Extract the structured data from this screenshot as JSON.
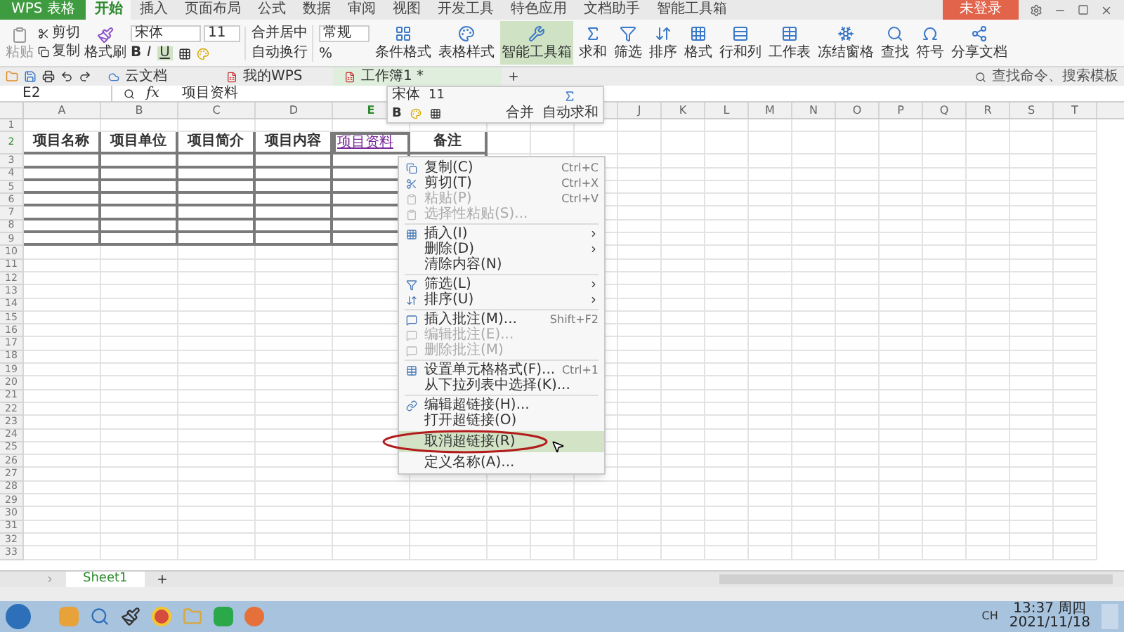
{
  "app_button": {
    "label": "WPS 表格"
  },
  "menu_tabs": [
    {
      "label": "开始",
      "selected": true
    },
    {
      "label": "插入",
      "selected": false
    },
    {
      "label": "页面布局",
      "selected": false
    },
    {
      "label": "公式",
      "selected": false
    },
    {
      "label": "数据",
      "selected": false
    },
    {
      "label": "审阅",
      "selected": false
    },
    {
      "label": "视图",
      "selected": false
    },
    {
      "label": "开发工具",
      "selected": false
    },
    {
      "label": "特色应用",
      "selected": false
    },
    {
      "label": "文档助手",
      "selected": false
    },
    {
      "label": "智能工具箱",
      "selected": false
    }
  ],
  "login_button": {
    "label": "未登录"
  },
  "ribbon": {
    "paste": "粘贴",
    "cut": "剪切",
    "copy": "复制",
    "format_painter": "格式刷",
    "font": "宋体",
    "font_size": "11",
    "bold": "B",
    "italic": "I",
    "underline": "U",
    "merge": "合并居中",
    "wrap": "自动换行",
    "number_format": "常规",
    "percent": "%",
    "tools": [
      {
        "label": "条件格式",
        "selected": false
      },
      {
        "label": "表格样式",
        "selected": false
      },
      {
        "label": "智能工具箱",
        "selected": true
      },
      {
        "label": "求和",
        "selected": false
      },
      {
        "label": "筛选",
        "selected": false
      },
      {
        "label": "排序",
        "selected": false
      },
      {
        "label": "格式",
        "selected": false
      },
      {
        "label": "行和列",
        "selected": false
      },
      {
        "label": "工作表",
        "selected": false
      },
      {
        "label": "冻结窗格",
        "selected": false
      },
      {
        "label": "查找",
        "selected": false
      },
      {
        "label": "符号",
        "selected": false
      },
      {
        "label": "分享文档",
        "selected": false
      }
    ],
    "search_placeholder": "查找命令、搜索模板"
  },
  "doc_tabs": [
    {
      "label": "云文档",
      "selected": false
    },
    {
      "label": "我的WPS",
      "selected": false
    },
    {
      "label": "工作簿1 *",
      "selected": true
    }
  ],
  "formula_bar": {
    "cell_ref": "E2",
    "fx": "fx",
    "value": "项目资料"
  },
  "mini_toolbar": {
    "font": "宋体",
    "size": "11",
    "bold": "B",
    "merge": "合并",
    "autosum": "自动求和"
  },
  "sheet": {
    "columns_left": [
      "A",
      "B",
      "C",
      "D",
      "E"
    ],
    "columns_right": [
      "J",
      "K",
      "L",
      "M",
      "N",
      "O",
      "P",
      "Q",
      "R",
      "S",
      "T"
    ],
    "rows": [
      "1",
      "2",
      "3",
      "4",
      "5",
      "6",
      "7",
      "8",
      "9",
      "10",
      "11",
      "12",
      "13",
      "14",
      "15",
      "16",
      "17",
      "18",
      "19",
      "20",
      "21",
      "22",
      "23",
      "24",
      "25",
      "26",
      "27",
      "28",
      "29",
      "30",
      "31",
      "32",
      "33"
    ],
    "header_cells": [
      {
        "text": "项目名称",
        "kind": "text",
        "selected": false
      },
      {
        "text": "项目单位",
        "kind": "text",
        "selected": false
      },
      {
        "text": "项目简介",
        "kind": "text",
        "selected": false
      },
      {
        "text": "项目内容",
        "kind": "text",
        "selected": false
      },
      {
        "text": "项目资料",
        "kind": "link",
        "selected": true
      },
      {
        "text": "备注",
        "kind": "text",
        "selected": false
      }
    ]
  },
  "context_menu": [
    {
      "kind": "item",
      "label": "复制(C)",
      "shortcut": "Ctrl+C",
      "disabled": false,
      "submenu": false,
      "selected": false
    },
    {
      "kind": "item",
      "label": "剪切(T)",
      "shortcut": "Ctrl+X",
      "disabled": false,
      "submenu": false,
      "selected": false
    },
    {
      "kind": "item",
      "label": "粘贴(P)",
      "shortcut": "Ctrl+V",
      "disabled": true,
      "submenu": false,
      "selected": false
    },
    {
      "kind": "item",
      "label": "选择性粘贴(S)...",
      "disabled": true,
      "submenu": false,
      "selected": false
    },
    {
      "kind": "separator"
    },
    {
      "kind": "item",
      "label": "插入(I)",
      "disabled": false,
      "submenu": true,
      "selected": false
    },
    {
      "kind": "item",
      "label": "删除(D)",
      "disabled": false,
      "submenu": true,
      "selected": false
    },
    {
      "kind": "item",
      "label": "清除内容(N)",
      "disabled": false,
      "submenu": false,
      "selected": false
    },
    {
      "kind": "separator"
    },
    {
      "kind": "item",
      "label": "筛选(L)",
      "disabled": false,
      "submenu": true,
      "selected": false
    },
    {
      "kind": "item",
      "label": "排序(U)",
      "disabled": false,
      "submenu": true,
      "selected": false
    },
    {
      "kind": "separator"
    },
    {
      "kind": "item",
      "label": "插入批注(M)...",
      "shortcut": "Shift+F2",
      "disabled": false,
      "submenu": false,
      "selected": false
    },
    {
      "kind": "item",
      "label": "编辑批注(E)...",
      "disabled": true,
      "submenu": false,
      "selected": false
    },
    {
      "kind": "item",
      "label": "删除批注(M)",
      "disabled": true,
      "submenu": false,
      "selected": false
    },
    {
      "kind": "separator"
    },
    {
      "kind": "item",
      "label": "设置单元格格式(F)...",
      "shortcut": "Ctrl+1",
      "disabled": false,
      "submenu": false,
      "selected": false
    },
    {
      "kind": "item",
      "label": "从下拉列表中选择(K)...",
      "disabled": false,
      "submenu": false,
      "selected": false
    },
    {
      "kind": "separator"
    },
    {
      "kind": "item",
      "label": "编辑超链接(H)...",
      "disabled": false,
      "submenu": false,
      "selected": false
    },
    {
      "kind": "item",
      "label": "打开超链接(O)",
      "disabled": false,
      "submenu": false,
      "selected": false
    },
    {
      "kind": "item",
      "label": "取消超链接(R)",
      "disabled": false,
      "submenu": false,
      "selected": true
    },
    {
      "kind": "item",
      "label": "定义名称(A)...",
      "disabled": false,
      "submenu": false,
      "selected": false
    }
  ],
  "sheet_tabs": [
    {
      "label": "Sheet1",
      "selected": true
    }
  ],
  "taskbar": {
    "lang": "CH",
    "time": "13:37 周四",
    "date": "2021/11/18"
  }
}
